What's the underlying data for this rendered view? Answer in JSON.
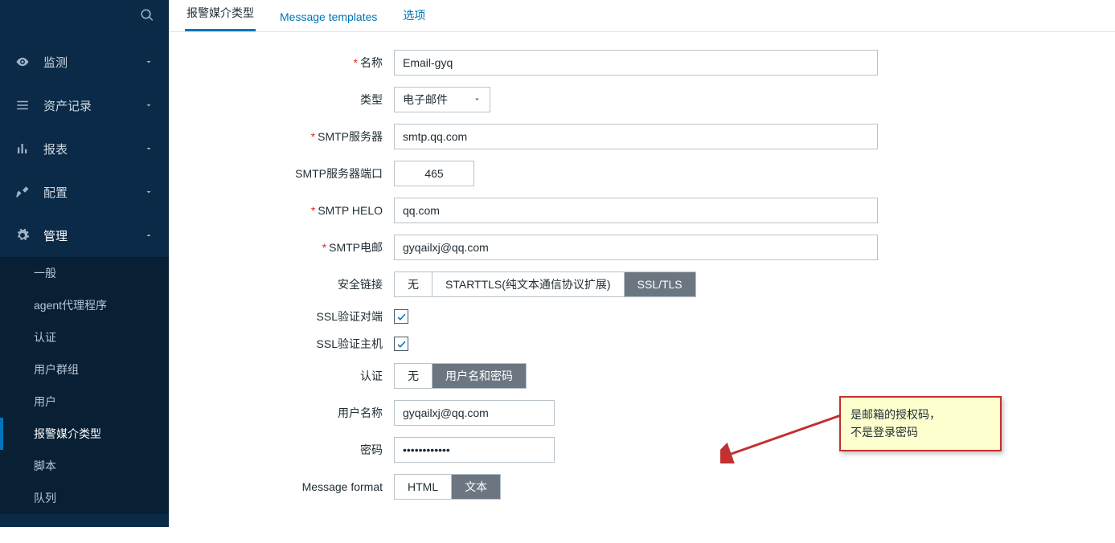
{
  "sidebar": {
    "nav": [
      {
        "id": "monitoring",
        "label": "监测"
      },
      {
        "id": "inventory",
        "label": "资产记录"
      },
      {
        "id": "reports",
        "label": "报表"
      },
      {
        "id": "config",
        "label": "配置"
      },
      {
        "id": "admin",
        "label": "管理"
      }
    ],
    "admin_sub": [
      {
        "id": "general",
        "label": "一般"
      },
      {
        "id": "agent",
        "label": "agent代理程序"
      },
      {
        "id": "auth",
        "label": "认证"
      },
      {
        "id": "usergroups",
        "label": "用户群组"
      },
      {
        "id": "users",
        "label": "用户"
      },
      {
        "id": "mediatypes",
        "label": "报警媒介类型"
      },
      {
        "id": "scripts",
        "label": "脚本"
      },
      {
        "id": "queue",
        "label": "队列"
      }
    ],
    "active_sub": "mediatypes"
  },
  "tabs": {
    "items": [
      {
        "id": "mediatype",
        "label": "报警媒介类型"
      },
      {
        "id": "templates",
        "label": "Message templates"
      },
      {
        "id": "options",
        "label": "选项"
      }
    ],
    "active": "mediatype"
  },
  "form": {
    "name_label": "名称",
    "name_value": "Email-gyq",
    "type_label": "类型",
    "type_value": "电子邮件",
    "smtp_server_label": "SMTP服务器",
    "smtp_server_value": "smtp.qq.com",
    "smtp_port_label": "SMTP服务器端口",
    "smtp_port_value": "465",
    "smtp_helo_label": "SMTP HELO",
    "smtp_helo_value": "qq.com",
    "smtp_email_label": "SMTP电邮",
    "smtp_email_value": "gyqailxj@qq.com",
    "security_label": "安全链接",
    "security_options": [
      "无",
      "STARTTLS(纯文本通信协议扩展)",
      "SSL/TLS"
    ],
    "security_selected": 2,
    "ssl_peer_label": "SSL验证对端",
    "ssl_peer_checked": true,
    "ssl_host_label": "SSL验证主机",
    "ssl_host_checked": true,
    "auth_label": "认证",
    "auth_options": [
      "无",
      "用户名和密码"
    ],
    "auth_selected": 1,
    "username_label": "用户名称",
    "username_value": "gyqailxj@qq.com",
    "password_label": "密码",
    "password_value": "••••••••••••",
    "msgformat_label": "Message format",
    "msgformat_options": [
      "HTML",
      "文本"
    ],
    "msgformat_selected": 1
  },
  "callout": {
    "line1": "是邮箱的授权码，",
    "line2": "不是登录密码"
  }
}
